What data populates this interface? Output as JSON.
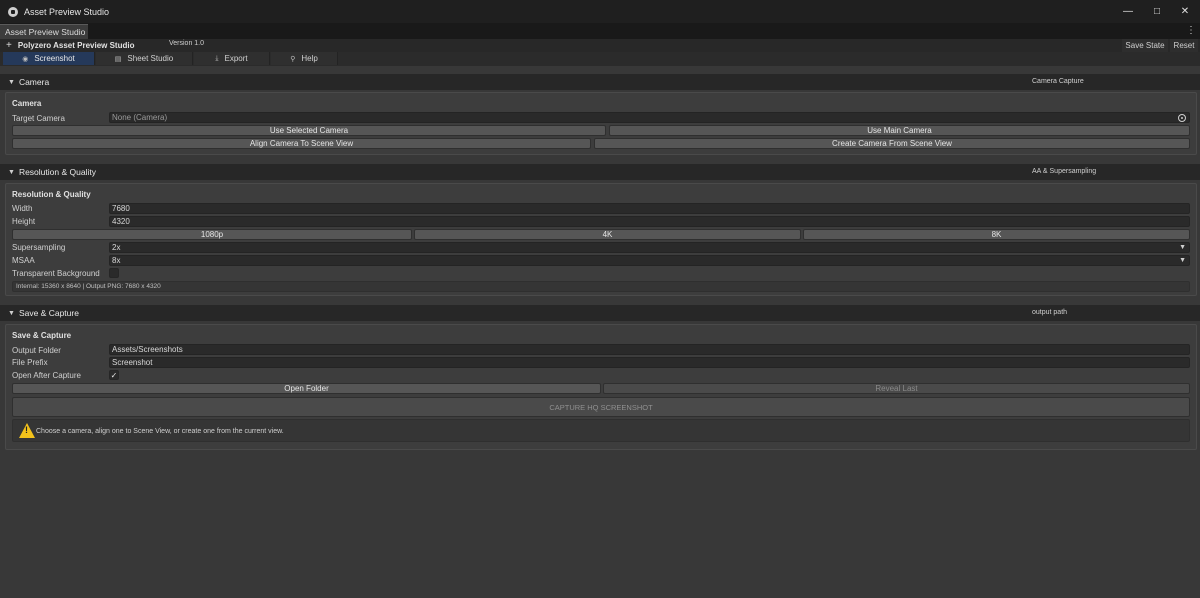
{
  "window": {
    "title": "Asset Preview Studio"
  },
  "doc_tab": "Asset Preview Studio",
  "header": {
    "brand": "Polyzero  Asset Preview Studio",
    "version": "Version 1.0",
    "save_state": "Save State",
    "reset": "Reset"
  },
  "nav": {
    "tabs": [
      {
        "label": "Screenshot",
        "icon": "camera-icon",
        "active": true
      },
      {
        "label": "Sheet Studio",
        "icon": "sheet-icon",
        "active": false
      },
      {
        "label": "Export",
        "icon": "export-icon",
        "active": false
      },
      {
        "label": "Help",
        "icon": "help-bulb-icon",
        "active": false
      }
    ]
  },
  "camera": {
    "section_title": "Camera",
    "section_right": "Camera Capture",
    "panel_title": "Camera",
    "target_label": "Target Camera",
    "target_value": "None (Camera)",
    "use_selected": "Use Selected Camera",
    "use_main": "Use Main Camera",
    "align": "Align Camera To Scene View",
    "create": "Create Camera From Scene View"
  },
  "resolution": {
    "section_title": "Resolution & Quality",
    "section_right": "AA & Supersampling",
    "panel_title": "Resolution & Quality",
    "width_label": "Width",
    "width_value": "7680",
    "height_label": "Height",
    "height_value": "4320",
    "presets": [
      "1080p",
      "4K",
      "8K"
    ],
    "supersampling_label": "Supersampling",
    "supersampling_value": "2x",
    "msaa_label": "MSAA",
    "msaa_value": "8x",
    "transparent_label": "Transparent Background",
    "transparent_checked": false,
    "info": "Internal: 15360 x 8640  |  Output PNG: 7680 x 4320"
  },
  "save": {
    "section_title": "Save & Capture",
    "section_right": "output path",
    "panel_title": "Save & Capture",
    "folder_label": "Output Folder",
    "folder_value": "Assets/Screenshots",
    "prefix_label": "File Prefix",
    "prefix_value": "Screenshot",
    "open_after_label": "Open After Capture",
    "open_after_checked": true,
    "open_folder": "Open Folder",
    "reveal_last": "Reveal Last",
    "capture": "CAPTURE HQ SCREENSHOT",
    "help": "Choose a camera, align one to Scene View, or create one from the current view."
  },
  "colors": {
    "accent_tab": "#25395a",
    "warning": "#f3c21b",
    "background": "#383838"
  }
}
